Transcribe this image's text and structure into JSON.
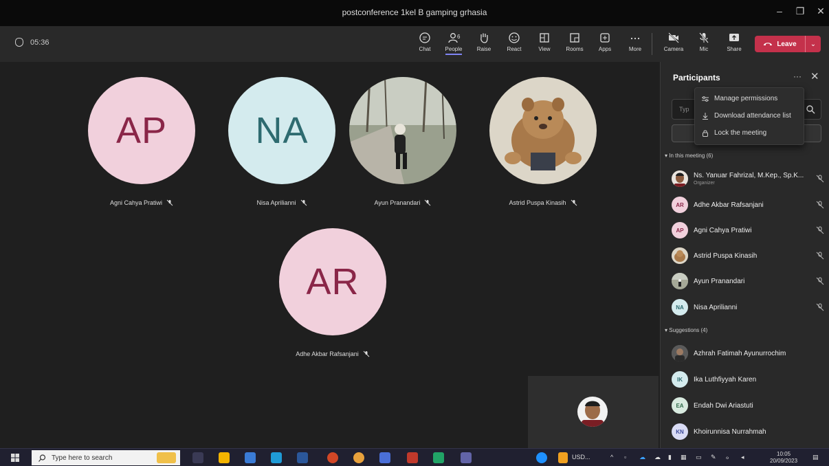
{
  "window": {
    "title": "postconference 1kel B gamping grhasia"
  },
  "toolbar": {
    "timer": "05:36",
    "people_count": "6",
    "buttons": [
      "Chat",
      "People",
      "Raise",
      "React",
      "View",
      "Rooms",
      "Apps",
      "More",
      "Camera",
      "Mic",
      "Share"
    ],
    "leave_label": "Leave",
    "accent": "#c4314b"
  },
  "stage": {
    "tiles": [
      {
        "initials": "AP",
        "name": "Agni Cahya Pratiwi",
        "bg": "#f1d0dc",
        "fg": "#8a2648"
      },
      {
        "initials": "NA",
        "name": "Nisa Aprilianni",
        "bg": "#d4ebee",
        "fg": "#2e6b70"
      },
      {
        "initials": "",
        "name": "Ayun Pranandari",
        "bg": "#9aa08e",
        "fg": "#fff"
      },
      {
        "initials": "",
        "name": "Astrid Puspa Kinasih",
        "bg": "#d8d2c4",
        "fg": "#fff"
      },
      {
        "initials": "AR",
        "name": "Adhe Akbar Rafsanjani",
        "bg": "#f1d0dc",
        "fg": "#8a2648"
      }
    ]
  },
  "panel": {
    "title": "Participants",
    "search_placeholder": "Typ",
    "menu": [
      "Manage permissions",
      "Download attendance list",
      "Lock the meeting"
    ],
    "in_meeting_label": "In this meeting (6)",
    "in_meeting": [
      {
        "initials": "",
        "name": "Ns. Yanuar Fahrizal, M.Kep., Sp.K...",
        "role": "Organizer",
        "bg": "#8a6a55"
      },
      {
        "initials": "AR",
        "name": "Adhe Akbar Rafsanjani",
        "role": "",
        "bg": "#f1d0dc"
      },
      {
        "initials": "AP",
        "name": "Agni Cahya Pratiwi",
        "role": "",
        "bg": "#f1d0dc"
      },
      {
        "initials": "",
        "name": "Astrid Puspa Kinasih",
        "role": "",
        "bg": "#b99a6a"
      },
      {
        "initials": "",
        "name": "Ayun Pranandari",
        "role": "",
        "bg": "#8c8f80"
      },
      {
        "initials": "NA",
        "name": "Nisa Aprilianni",
        "role": "",
        "bg": "#d4ebee"
      }
    ],
    "suggestions_label": "Suggestions (4)",
    "suggestions": [
      {
        "initials": "",
        "name": "Azhrah Fatimah Ayunurrochim",
        "bg": "#6a6a6a"
      },
      {
        "initials": "IK",
        "name": "Ika Luthfiyyah Karen",
        "bg": "#d4ebee"
      },
      {
        "initials": "EA",
        "name": "Endah Dwi Ariastuti",
        "bg": "#d8eadf"
      },
      {
        "initials": "KN",
        "name": "Khoirunnisa Nurrahmah",
        "bg": "#d9dcf5"
      }
    ]
  },
  "taskbar": {
    "search_placeholder": "Type here to search",
    "tray_text": "USD...",
    "time": "10:05",
    "date": "20/09/2023"
  }
}
